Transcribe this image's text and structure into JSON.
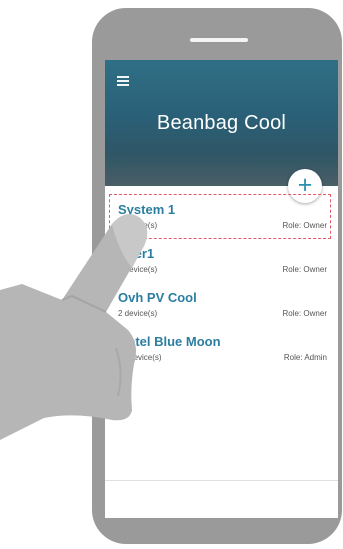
{
  "app": {
    "title": "Beanbag Cool",
    "add_button_symbol": "+"
  },
  "icons": {
    "menu": "hamburger-menu-icon",
    "add": "plus-icon",
    "cursor": "crosshair-cursor-icon",
    "hand": "pointing-hand-icon"
  },
  "colors": {
    "header": "#2a6077",
    "accent": "#2c7ea1",
    "highlight": "#e05a6a"
  },
  "systems": [
    {
      "name": "System 1",
      "devices": "2 device(s)",
      "role": "Role: Owner"
    },
    {
      "name": "User1",
      "devices": "2 device(s)",
      "role": "Role: Owner"
    },
    {
      "name": "Ovh PV Cool",
      "devices": "2 device(s)",
      "role": "Role: Owner"
    },
    {
      "name": "Hotel Blue Moon",
      "devices": "20 device(s)",
      "role": "Role: Admin"
    }
  ]
}
